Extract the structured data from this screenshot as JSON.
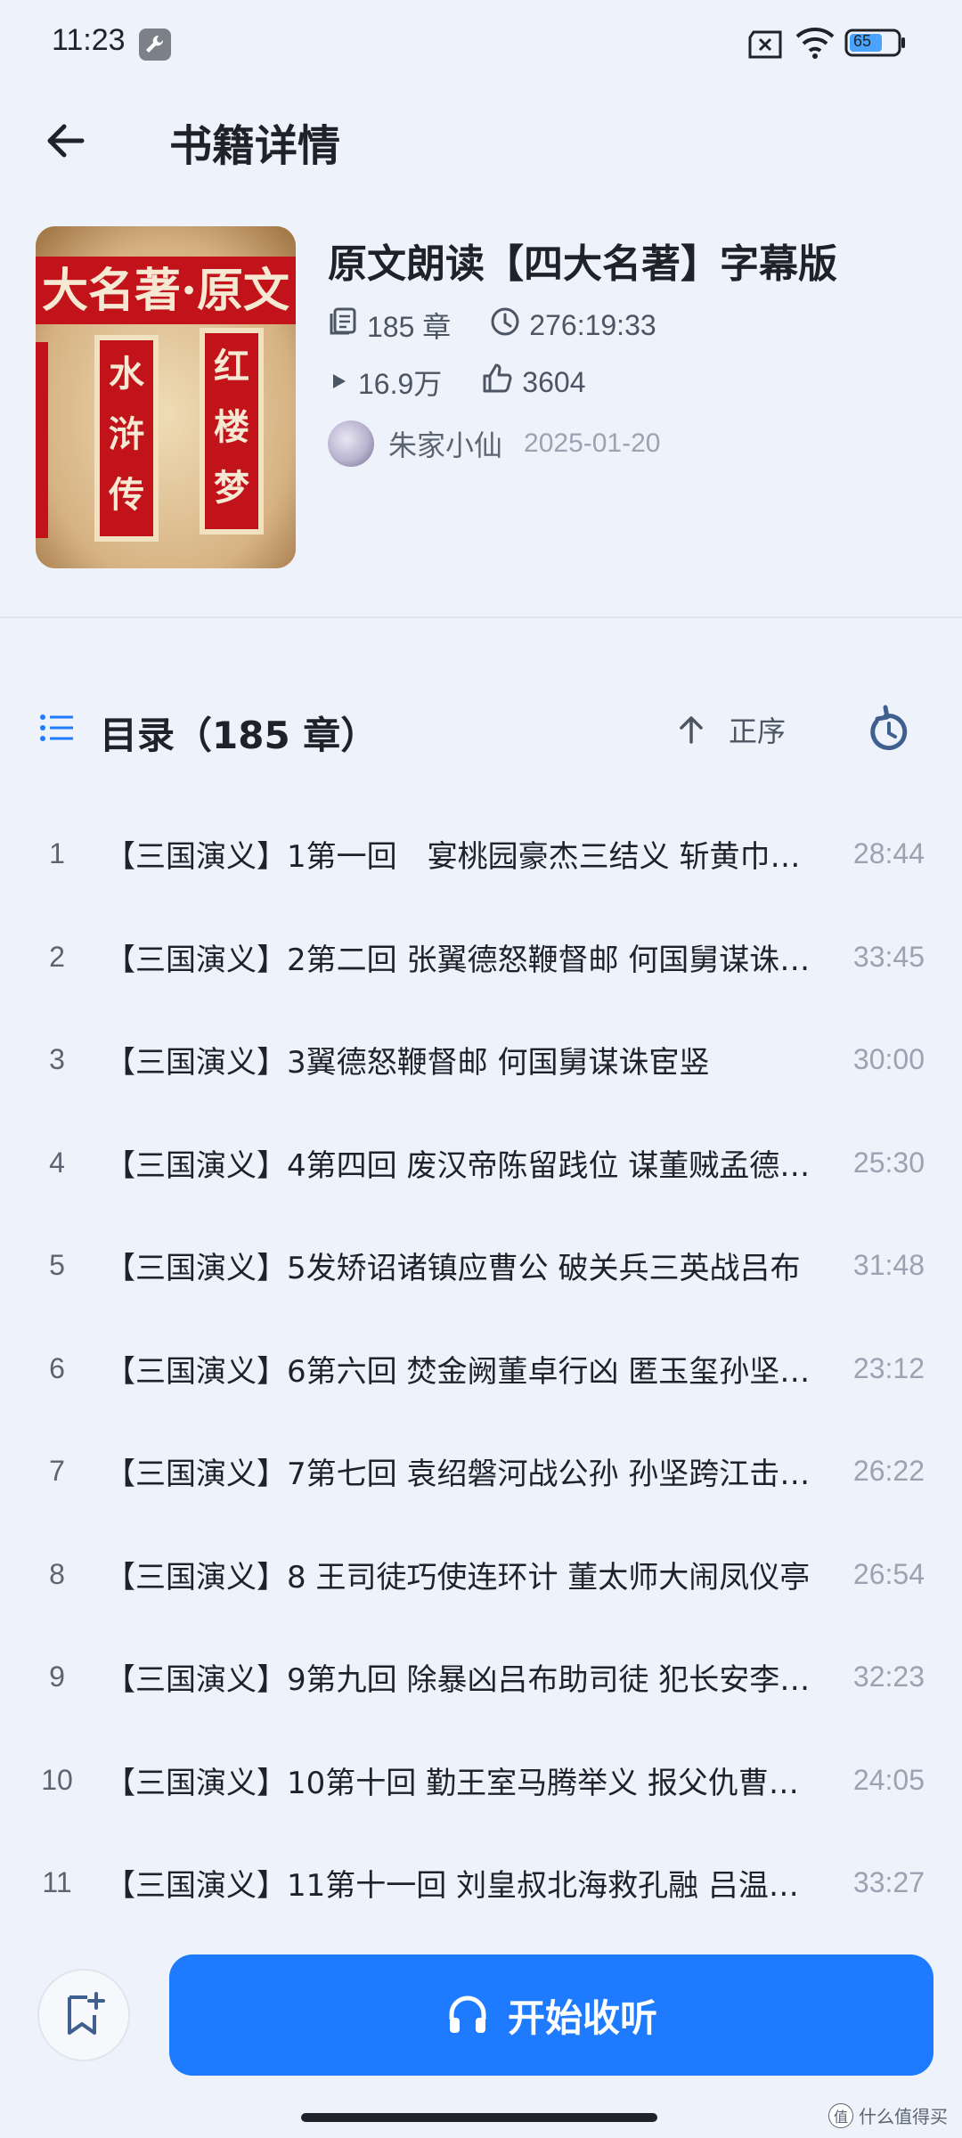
{
  "status_bar": {
    "time": "11:23",
    "battery": "65",
    "icons": [
      "wrench-icon",
      "sim-off-icon",
      "wifi-icon",
      "battery-icon"
    ]
  },
  "header": {
    "title": "书籍详情",
    "back_icon": "arrow-left-icon"
  },
  "book": {
    "title": "原文朗读【四大名著】字幕版",
    "chapters_count": "185 章",
    "total_duration": "276:19:33",
    "plays": "16.9万",
    "likes": "3604",
    "author": "朱家小仙",
    "date": "2025-01-20",
    "cover": {
      "banner": "大名著·原文",
      "left_plaque": "水浒传",
      "right_plaque": "红楼梦"
    }
  },
  "catalog": {
    "title": "目录（185 章）",
    "sort_label": "正序",
    "chapters": [
      {
        "index": "1",
        "title": "【三国演义】1第一回　宴桃园豪杰三结义 斩黄巾英雄首立功",
        "duration": "28:44"
      },
      {
        "index": "2",
        "title": "【三国演义】2第二回 张翼德怒鞭督邮 何国舅谋诛宦竖",
        "duration": "33:45"
      },
      {
        "index": "3",
        "title": "【三国演义】3翼德怒鞭督邮 何国舅谋诛宦竖",
        "duration": "30:00"
      },
      {
        "index": "4",
        "title": "【三国演义】4第四回 废汉帝陈留践位 谋董贼孟德献刀",
        "duration": "25:30"
      },
      {
        "index": "5",
        "title": "【三国演义】5发矫诏诸镇应曹公 破关兵三英战吕布",
        "duration": "31:48"
      },
      {
        "index": "6",
        "title": "【三国演义】6第六回 焚金阙董卓行凶 匿玉玺孙坚背约",
        "duration": "23:12"
      },
      {
        "index": "7",
        "title": "【三国演义】7第七回 袁绍磐河战公孙 孙坚跨江击刘表",
        "duration": "26:22"
      },
      {
        "index": "8",
        "title": "【三国演义】8 王司徒巧使连环计 董太师大闹凤仪亭",
        "duration": "26:54"
      },
      {
        "index": "9",
        "title": "【三国演义】9第九回 除暴凶吕布助司徒 犯长安李傕听贾诩",
        "duration": "32:23"
      },
      {
        "index": "10",
        "title": "【三国演义】10第十回 勤王室马腾举义 报父仇曹操兴师",
        "duration": "24:05"
      },
      {
        "index": "11",
        "title": "【三国演义】11第十一回 刘皇叔北海救孔融 吕温侯濮阳破曹操",
        "duration": "33:27"
      }
    ]
  },
  "bottom_bar": {
    "play_label": "开始收听",
    "bookmark_icon": "bookmark-add-icon",
    "play_icon": "headphones-icon"
  },
  "watermark": {
    "text": "什么值得买",
    "badge": "值"
  },
  "colors": {
    "background": "#eef3fb",
    "accent": "#1e7bff",
    "text_primary": "#1f2329",
    "text_secondary": "#5b6472",
    "text_muted": "#9aa3b2"
  }
}
